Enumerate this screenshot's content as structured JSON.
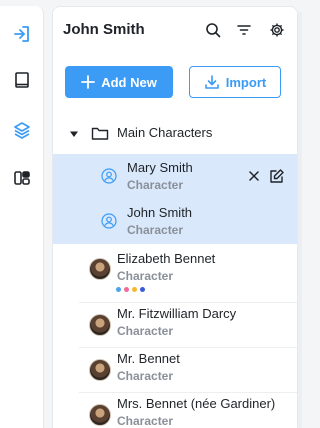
{
  "header": {
    "title": "John Smith"
  },
  "toolbar": {
    "add_label": "Add New",
    "import_label": "Import"
  },
  "tree": {
    "folder_label": "Main Characters",
    "items": [
      {
        "name": "Mary Smith",
        "type": "Character"
      },
      {
        "name": "John Smith",
        "type": "Character"
      },
      {
        "name": "Elizabeth Bennet",
        "type": "Character",
        "dots": [
          "#4aa3f0",
          "#f06a9a",
          "#f5b731",
          "#3b5bd6"
        ]
      },
      {
        "name": "Mr. Fitzwilliam Darcy",
        "type": "Character"
      },
      {
        "name": "Mr. Bennet",
        "type": "Character"
      },
      {
        "name": "Mrs. Bennet (née Gardiner)",
        "type": "Character"
      }
    ]
  },
  "colors": {
    "accent": "#3b9bf5",
    "selected_bg": "#d9e9fb"
  }
}
